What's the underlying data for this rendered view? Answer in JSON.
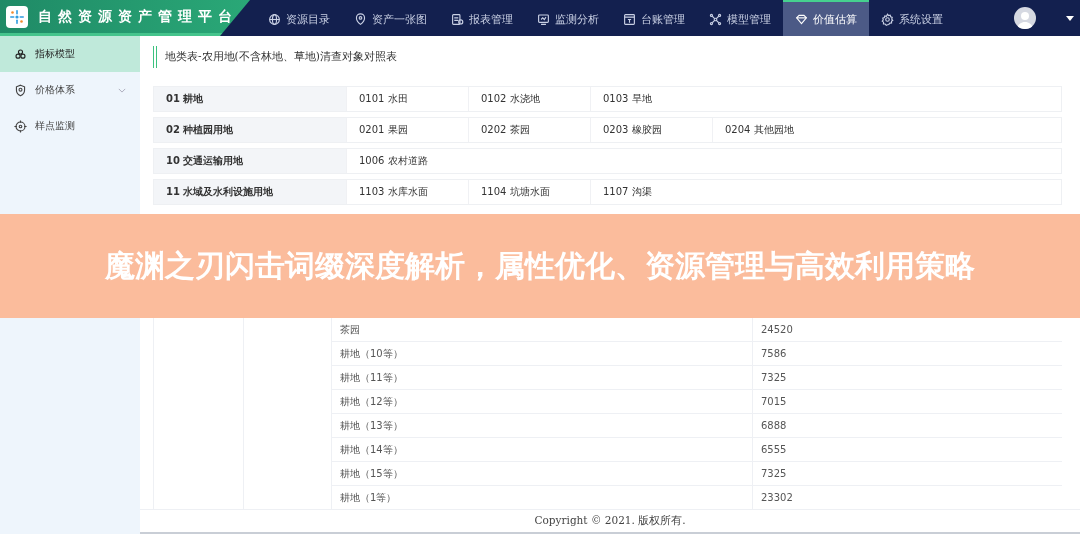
{
  "header": {
    "title": "自然资源资产管理平台",
    "nav": [
      {
        "label": "资源目录",
        "selected": false
      },
      {
        "label": "资产一张图",
        "selected": false
      },
      {
        "label": "报表管理",
        "selected": false
      },
      {
        "label": "监测分析",
        "selected": false
      },
      {
        "label": "台账管理",
        "selected": false
      },
      {
        "label": "模型管理",
        "selected": false
      },
      {
        "label": "价值估算",
        "selected": true
      },
      {
        "label": "系统设置",
        "selected": false
      }
    ]
  },
  "sidebar": {
    "items": [
      {
        "label": "指标模型",
        "selected": true,
        "expandable": false
      },
      {
        "label": "价格体系",
        "selected": false,
        "expandable": true
      },
      {
        "label": "样点监测",
        "selected": false,
        "expandable": false
      }
    ]
  },
  "section_title": "地类表-农用地(不含林地、草地)清查对象对照表",
  "lookup_rows": [
    {
      "category": "01  耕地",
      "items": [
        "0101 水田",
        "0102 水浇地",
        "0103 旱地"
      ]
    },
    {
      "category": "02  种植园用地",
      "items": [
        "0201 果园",
        "0202 茶园",
        "0203 橡胶园",
        "0204 其他园地"
      ]
    },
    {
      "category": "10  交通运输用地",
      "items": [
        "1006 农村道路"
      ]
    },
    {
      "category": "11  水域及水利设施用地",
      "items": [
        "1103 水库水面",
        "1104 坑塘水面",
        "1107 沟渠"
      ]
    }
  ],
  "banner": {
    "title": "魔渊之刃闪击词缀深度解析，属性优化、资源管理与高效利用策略"
  },
  "price_table": {
    "rows": [
      {
        "name": "茶园",
        "value": "24520"
      },
      {
        "name": "耕地（10等）",
        "value": "7586"
      },
      {
        "name": "耕地（11等）",
        "value": "7325"
      },
      {
        "name": "耕地（12等）",
        "value": "7015"
      },
      {
        "name": "耕地（13等）",
        "value": "6888"
      },
      {
        "name": "耕地（14等）",
        "value": "6555"
      },
      {
        "name": "耕地（15等）",
        "value": "7325"
      },
      {
        "name": "耕地（1等）",
        "value": "23302"
      }
    ]
  },
  "footer": "Copyright © 2021. 版权所有."
}
